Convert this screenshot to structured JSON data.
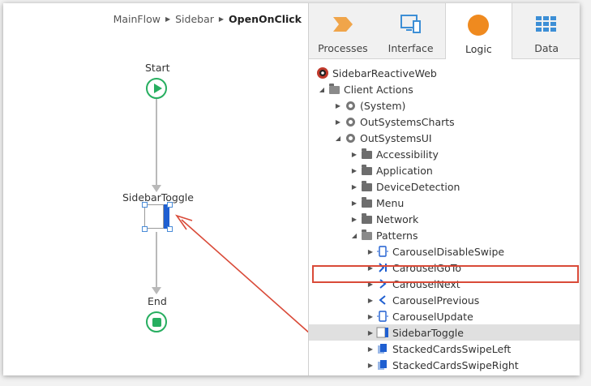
{
  "breadcrumb": {
    "item1": "MainFlow",
    "item2": "Sidebar",
    "current": "OpenOnClick"
  },
  "flow": {
    "start_label": "Start",
    "toggle_label": "SidebarToggle",
    "end_label": "End"
  },
  "tabs": [
    {
      "label": "Processes",
      "icon": "processes-icon",
      "color": "#f0a54a"
    },
    {
      "label": "Interface",
      "icon": "interface-icon",
      "color": "#3d8fd6"
    },
    {
      "label": "Logic",
      "icon": "logic-icon",
      "color": "#ef8a1f",
      "active": true
    },
    {
      "label": "Data",
      "icon": "data-icon",
      "color": "#3d8fd6"
    }
  ],
  "tree": {
    "root": "SidebarReactiveWeb",
    "client_actions": "Client Actions",
    "system": "(System)",
    "charts": "OutSystemsCharts",
    "ui": "OutSystemsUI",
    "accessibility": "Accessibility",
    "application": "Application",
    "device_detection": "DeviceDetection",
    "menu": "Menu",
    "network": "Network",
    "patterns": "Patterns",
    "carousel_disable_swipe": "CarouselDisableSwipe",
    "carousel_goto": "CarouselGoTo",
    "carousel_next": "CarouselNext",
    "carousel_previous": "CarouselPrevious",
    "carousel_update": "CarouselUpdate",
    "sidebar_toggle": "SidebarToggle",
    "stacked_left": "StackedCardsSwipeLeft",
    "stacked_right": "StackedCardsSwipeRight"
  },
  "colors": {
    "accent": "#ef8a1f",
    "selection_outline": "#d94a38",
    "flow_green": "#27ae60",
    "action_blue": "#1f5fd1"
  }
}
